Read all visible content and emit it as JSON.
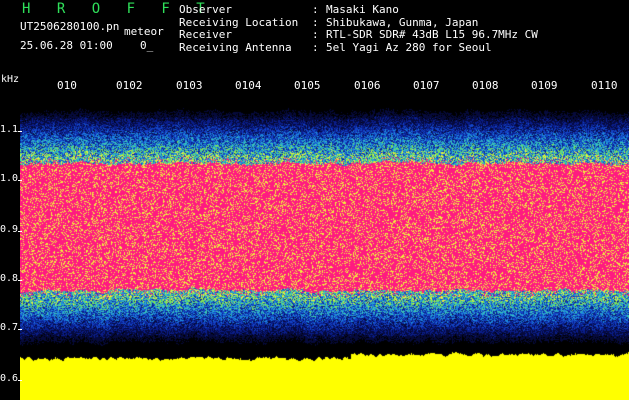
{
  "header": {
    "brand": "H R O F F T",
    "filename": "UT2506280100.pn",
    "tag": "meteor",
    "datetime": "25.06.28 01:00",
    "counter": "0_"
  },
  "info": [
    {
      "label": "Observer",
      "sep": ":",
      "value": "Masaki Kano"
    },
    {
      "label": "Receiving Location",
      "sep": ":",
      "value": "Shibukawa, Gunma, Japan"
    },
    {
      "label": "Receiver",
      "sep": ":",
      "value": "RTL-SDR SDR# 43dB L15 96.7MHz CW"
    },
    {
      "label": "Receiving Antenna",
      "sep": ":",
      "value": "5el Yagi Az 280 for Seoul"
    }
  ],
  "axis": {
    "unit": "kHz",
    "y_ticks": [
      "1.1",
      "1.0",
      "0.9",
      "0.8",
      "0.7",
      "0.6"
    ],
    "x_ticks": [
      "010",
      "0102",
      "0103",
      "0104",
      "0105",
      "0106",
      "0107",
      "0108",
      "0109",
      "0110"
    ]
  },
  "colors": {
    "brand": "#2fe05a",
    "signal": "#ff1a80",
    "noise_floor": "#ffff00",
    "background": "#000000"
  }
}
